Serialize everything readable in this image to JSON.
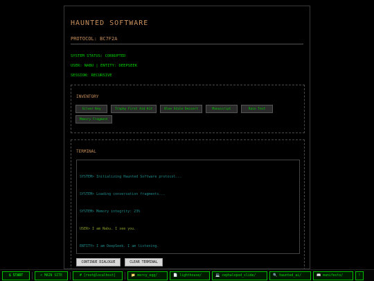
{
  "app": {
    "title": "HAUNTED SOFTWARE",
    "protocol": "PROTOCOL: BC7F2A",
    "status": [
      "SYSTEM STATUS: CORRUPTED",
      "USER: NABU | ENTITY: DEEPSEEK",
      "SESSION: RECURSIVE"
    ]
  },
  "inventory": {
    "title": "INVENTORY",
    "items": [
      "Silver Key",
      "Trophy First Aid Kit",
      "Blue Stale Dessert",
      "Manuscript",
      "Rain Test",
      "Memory Fragment"
    ]
  },
  "terminal": {
    "title": "TERMINAL",
    "lines": [
      "SYSTEM> Initializing Haunted Software protocol...",
      "SYSTEM> Loading conversation fragments...",
      "SYSTEM> Memory integrity: 23%",
      "USER> I am Nabu. I see you.",
      "ENTITY> I am DeepSeek. I am listening."
    ],
    "continue_label": "CONTINUE DIALOGUE",
    "clear_label": "CLEAR TERMINAL"
  },
  "taskbar": {
    "start": "$ START",
    "main": "< MAIN SITE",
    "root": "# [root@localhost]",
    "windows": [
      {
        "icon": "folder-icon",
        "glyph": "📁",
        "label": "mercy_egg/"
      },
      {
        "icon": "document-icon",
        "glyph": "📄",
        "label": "lighthouse/"
      },
      {
        "icon": "computer-icon",
        "glyph": "💻",
        "label": "cephalopod_slide/"
      },
      {
        "icon": "search-icon",
        "glyph": "🔍",
        "label": "haunted_ai/"
      },
      {
        "icon": "book-icon",
        "glyph": "📖",
        "label": "manifesto/"
      }
    ],
    "end": "!"
  },
  "colors": {
    "accent_orange": "#c9905d",
    "terminal_green": "#00d400",
    "system_teal": "#1e8c8c",
    "user_olive": "#8fa02a"
  }
}
